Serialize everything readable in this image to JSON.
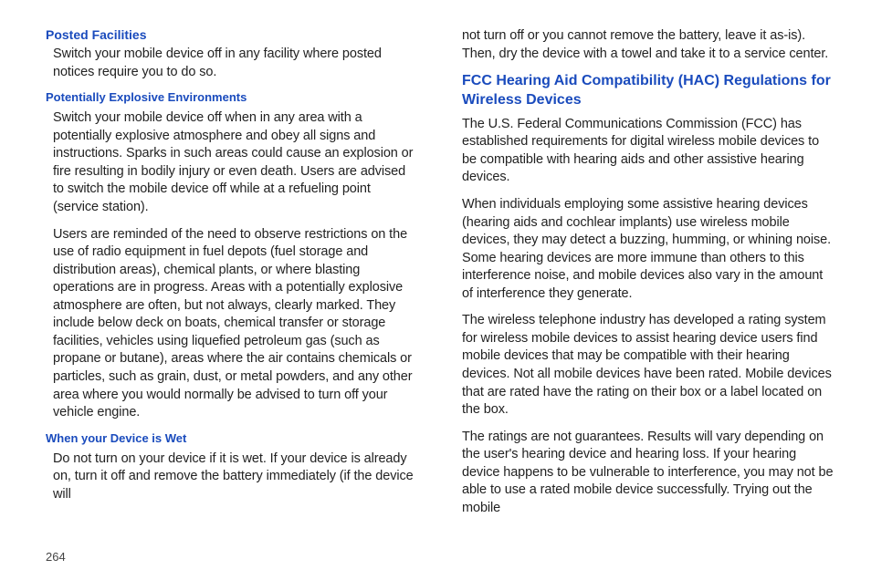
{
  "left": {
    "h1": "Posted Facilities",
    "p1": "Switch your mobile device off in any facility where posted notices require you to do so.",
    "h2": "Potentially Explosive Environments",
    "p2": "Switch your mobile device off when in any area with a potentially explosive atmosphere and obey all signs and instructions. Sparks in such areas could cause an explosion or fire resulting in bodily injury or even death. Users are advised to switch the mobile device off while at a refueling point (service station).",
    "p3": "Users are reminded of the need to observe restrictions on the use of radio equipment in fuel depots (fuel storage and distribution areas), chemical plants, or where blasting operations are in progress. Areas with a potentially explosive atmosphere are often, but not always, clearly marked. They include below deck on boats, chemical transfer or storage facilities, vehicles using liquefied petroleum gas (such as propane or butane), areas where the air contains chemicals or particles, such as grain, dust, or metal powders, and any other area where you would normally be advised to turn off your vehicle engine.",
    "h3": "When your Device is Wet",
    "p4": "Do not turn on your device if it is wet. If your device is already on, turn it off and remove the battery immediately (if the device will"
  },
  "right": {
    "p1": "not turn off or you cannot remove the battery, leave it as-is). Then, dry the device with a towel and take it to a service center.",
    "h1": "FCC Hearing Aid Compatibility (HAC) Regulations for Wireless Devices",
    "p2": "The U.S. Federal Communications Commission (FCC) has established requirements for digital wireless mobile devices to be compatible with hearing aids and other assistive hearing devices.",
    "p3": "When individuals employing some assistive hearing devices (hearing aids and cochlear implants) use wireless mobile devices, they may detect a buzzing, humming, or whining noise. Some hearing devices are more immune than others to this interference noise, and mobile devices also vary in the amount of interference they generate.",
    "p4": "The wireless telephone industry has developed a rating system for wireless mobile devices to assist hearing device users find mobile devices that may be compatible with their hearing devices. Not all mobile devices have been rated. Mobile devices that are rated have the rating on their box or a label located on the box.",
    "p5": "The ratings are not guarantees. Results will vary depending on the user's hearing device and hearing loss. If your hearing device happens to be vulnerable to interference, you may not be able to use a rated mobile device successfully. Trying out the mobile"
  },
  "pageNumber": "264"
}
